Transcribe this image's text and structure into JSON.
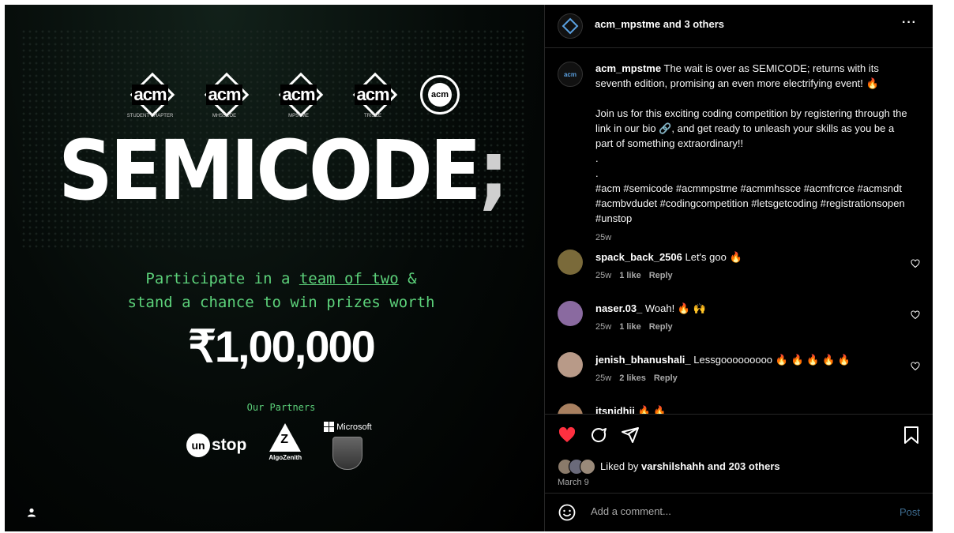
{
  "post_image": {
    "logos": [
      {
        "text": "acm",
        "sub": "STUDENT CHAPTER"
      },
      {
        "text": "acm",
        "sub": "MHSSCOE"
      },
      {
        "text": "acm",
        "sub": "MPSTME"
      },
      {
        "text": "acm",
        "sub": "TRISCE"
      },
      {
        "text": "acm",
        "sub": ""
      }
    ],
    "title": "SEMICODE",
    "title_suffix": ";",
    "tagline_line1_a": "Participate in a ",
    "tagline_line1_link": "team of two",
    "tagline_line1_b": " &",
    "tagline_line2": "stand a chance to win prizes worth",
    "prize": "₹1,00,000",
    "partners_label": "Our Partners",
    "partners": {
      "unstop_a": "un",
      "unstop_b": "stop",
      "algo_label": "AlgoZenith",
      "microsoft": "Microsoft"
    }
  },
  "header": {
    "account": "acm_mpstme",
    "collab": " and 3 others",
    "more_icon": "more-horizontal-icon"
  },
  "caption": {
    "username": "acm_mpstme",
    "para1": "The wait is over as SEMICODE; returns with its seventh edition, promising an even more electrifying event!",
    "para2": "Join us for this exciting coding competition by registering through the link in our bio 🔗, and get ready to unleash your skills as you be a part of something extraordinary!!",
    "dot1": ".",
    "dot2": ".",
    "hashtags": "#acm #semicode #acmmpstme #acmmhssce #acmfrcrce #acmsndt #acmbvdudet #codingcompetition #letsgetcoding #registrationsopen #unstop",
    "time": "25w"
  },
  "comments": [
    {
      "user": "spack_back_2506",
      "text": " Let's goo ",
      "emoji": "🔥",
      "time": "25w",
      "likes": "1 like",
      "reply": "Reply",
      "avatar_color": "#7a6a3a"
    },
    {
      "user": "naser.03_",
      "text": " Woah! ",
      "emoji": "🔥 🙌",
      "time": "25w",
      "likes": "1 like",
      "reply": "Reply",
      "avatar_color": "#8a6aa0"
    },
    {
      "user": "jenish_bhanushali_",
      "text": " Lessgooooooooo ",
      "emoji": "🔥 🔥 🔥 🔥 🔥",
      "time": "25w",
      "likes": "2 likes",
      "reply": "Reply",
      "avatar_color": "#b89a88"
    },
    {
      "user": "itsnidhii",
      "text": " ",
      "emoji": "🔥 🔥",
      "time": "",
      "likes": "",
      "reply": "",
      "avatar_color": "#a88060"
    }
  ],
  "actions": {
    "liked_prefix": "Liked by ",
    "liked_user": "varshilshahh",
    "liked_suffix": " and 203 others",
    "date": "March 9"
  },
  "add_comment": {
    "placeholder": "Add a comment...",
    "post": "Post"
  },
  "colors": {
    "accent_green": "#5cd17a",
    "like_red": "#ff3040",
    "link_blue": "#3d6b8f"
  }
}
